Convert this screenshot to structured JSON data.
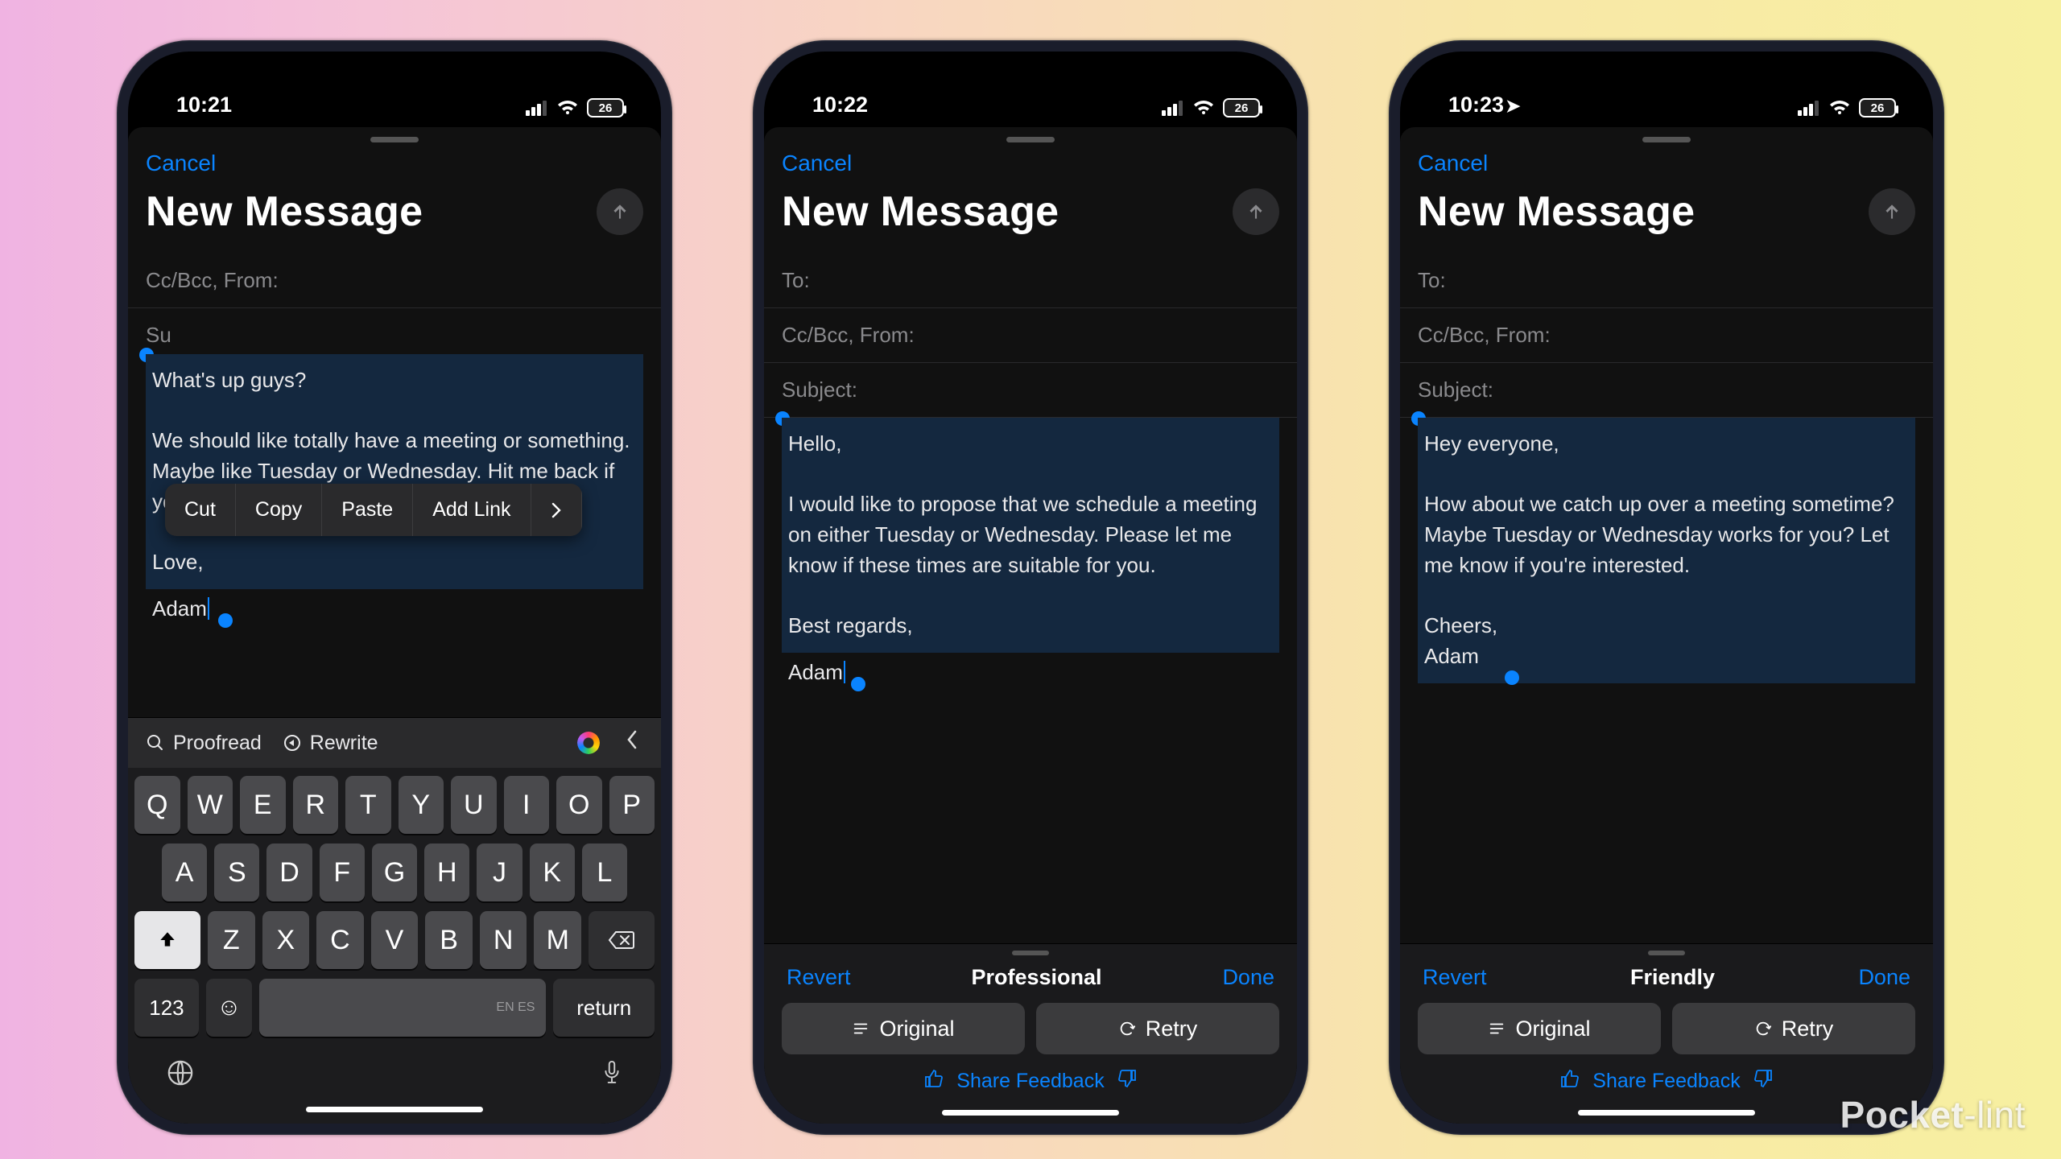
{
  "watermark": {
    "bold": "Pocket",
    "thin": "-lint"
  },
  "common": {
    "cancel": "Cancel",
    "title": "New Message",
    "battery": "26",
    "field_to": "To:",
    "field_cc": "Cc/Bcc, From:",
    "field_subject_full": "Subject:",
    "field_subject_trunc": "Su"
  },
  "editMenu": {
    "cut": "Cut",
    "copy": "Copy",
    "paste": "Paste",
    "addLink": "Add Link"
  },
  "kbTools": {
    "proofread": "Proofread",
    "rewrite": "Rewrite"
  },
  "keyboard": {
    "row1": [
      "Q",
      "W",
      "E",
      "R",
      "T",
      "Y",
      "U",
      "I",
      "O",
      "P"
    ],
    "row2": [
      "A",
      "S",
      "D",
      "F",
      "G",
      "H",
      "J",
      "K",
      "L"
    ],
    "row3": [
      "Z",
      "X",
      "C",
      "V",
      "B",
      "N",
      "M"
    ],
    "num": "123",
    "spaceHint": "EN ES",
    "ret": "return"
  },
  "tone": {
    "revert": "Revert",
    "done": "Done",
    "original": "Original",
    "retry": "Retry",
    "feedback": "Share Feedback"
  },
  "phones": [
    {
      "time": "10:21",
      "showLocation": false,
      "body_sel": "What's up guys?\n\nWe should like totally have a meeting or something. Maybe like Tuesday or Wednesday. Hit me back if you're down.\n\nLove,",
      "after": "Adam"
    },
    {
      "time": "10:22",
      "showLocation": false,
      "toneLabel": "Professional",
      "body_sel": "Hello,\n\nI would like to propose that we schedule a meeting on either Tuesday or Wednesday. Please let me know if these times are suitable for you.\n\nBest regards,",
      "after": "Adam"
    },
    {
      "time": "10:23",
      "showLocation": true,
      "toneLabel": "Friendly",
      "body_sel": "Hey everyone,\n\nHow about we catch up over a meeting sometime? Maybe Tuesday or Wednesday works for you? Let me know if you're interested.\n\nCheers,\nAdam",
      "after": ""
    }
  ]
}
